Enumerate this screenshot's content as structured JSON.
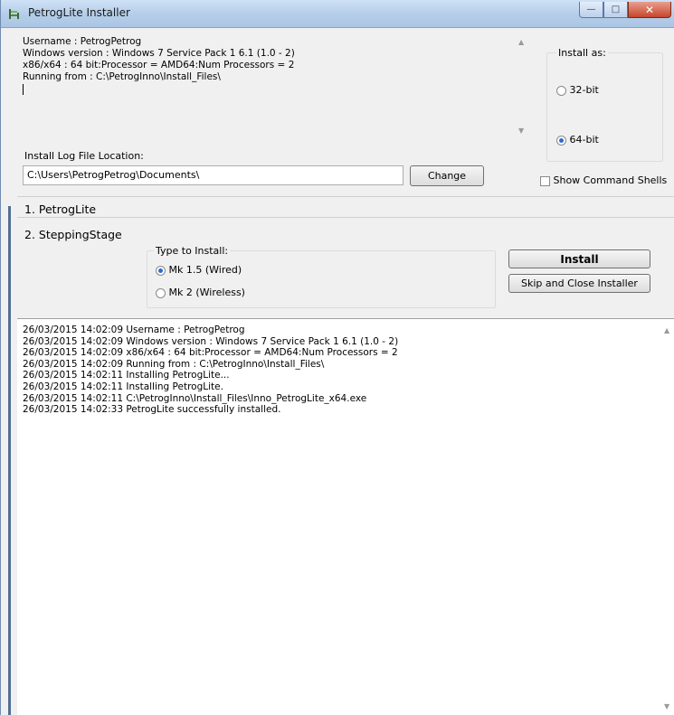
{
  "window": {
    "title": "PetrogLite Installer",
    "controls": {
      "minimize": "—",
      "maximize": "□",
      "close": "✕"
    }
  },
  "info": {
    "lines": [
      "Username : PetrogPetrog",
      "Windows version : Windows 7 Service Pack 1 6.1 (1.0 - 2)",
      "x86/x64 : 64 bit:Processor = AMD64:Num Processors = 2",
      "Running from : C:\\PetrogInno\\Install_Files\\"
    ]
  },
  "install_as": {
    "label": "Install as:",
    "options": [
      {
        "label": "32-bit",
        "selected": false
      },
      {
        "label": "64-bit",
        "selected": true
      }
    ]
  },
  "log_location": {
    "label": "Install Log File Location:",
    "value": "C:\\Users\\PetrogPetrog\\Documents\\",
    "change_label": "Change"
  },
  "show_command_shells": {
    "label": "Show Command Shells",
    "checked": false
  },
  "sections": {
    "petroglite": "1. PetrogLite",
    "steppingstage": "2. SteppingStage"
  },
  "type_to_install": {
    "label": "Type to Install:",
    "options": [
      {
        "label": "Mk 1.5 (Wired)",
        "selected": true
      },
      {
        "label": "Mk 2 (Wireless)",
        "selected": false
      }
    ]
  },
  "actions": {
    "install_label": "Install",
    "skip_label": "Skip and Close Installer"
  },
  "log": [
    "26/03/2015 14:02:09 Username : PetrogPetrog",
    "26/03/2015 14:02:09 Windows version : Windows 7 Service Pack 1 6.1 (1.0 - 2)",
    "26/03/2015 14:02:09 x86/x64 : 64 bit:Processor = AMD64:Num Processors = 2",
    "26/03/2015 14:02:09 Running from : C:\\PetrogInno\\Install_Files\\",
    "26/03/2015 14:02:11 Installing PetrogLite...",
    "26/03/2015 14:02:11 Installing PetrogLite.",
    "26/03/2015 14:02:11 C:\\PetrogInno\\Install_Files\\Inno_PetrogLite_x64.exe",
    "26/03/2015 14:02:33 PetrogLite successfully installed."
  ]
}
